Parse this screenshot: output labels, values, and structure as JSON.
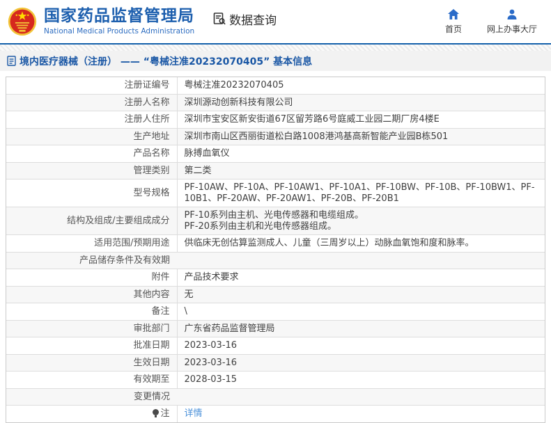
{
  "header": {
    "logo": {
      "title": "国家药品监督管理局",
      "subtitle": "National Medical Products Administration"
    },
    "section": {
      "label": "数据查询"
    },
    "nav": [
      {
        "label": "首页"
      },
      {
        "label": "网上办事大厅"
      }
    ]
  },
  "breadcrumb": {
    "text": "境内医疗器械（注册） —— “粤械注准20232070405” 基本信息"
  },
  "table": {
    "rows": [
      {
        "label": "注册证编号",
        "value": "粤械注准20232070405"
      },
      {
        "label": "注册人名称",
        "value": "深圳源动创新科技有限公司"
      },
      {
        "label": "注册人住所",
        "value": "深圳市宝安区新安街道67区留芳路6号庭威工业园二期厂房4楼E"
      },
      {
        "label": "生产地址",
        "value": "深圳市南山区西丽街道松白路1008港鸿基高新智能产业园B栋501"
      },
      {
        "label": "产品名称",
        "value": "脉搏血氧仪"
      },
      {
        "label": "管理类别",
        "value": "第二类"
      },
      {
        "label": "型号规格",
        "value": "PF-10AW、PF-10A、PF-10AW1、PF-10A1、PF-10BW、PF-10B、PF-10BW1、PF-10B1、PF-20AW、PF-20AW1、PF-20B、PF-20B1"
      },
      {
        "label": "结构及组成/主要组成成分",
        "value": "PF-10系列由主机、光电传感器和电缆组成。\nPF-20系列由主机和光电传感器组成。"
      },
      {
        "label": "适用范围/预期用途",
        "value": "供临床无创估算监测成人、儿童（三周岁以上）动脉血氧饱和度和脉率。"
      },
      {
        "label": "产品储存条件及有效期",
        "value": ""
      },
      {
        "label": "附件",
        "value": "产品技术要求"
      },
      {
        "label": "其他内容",
        "value": "无"
      },
      {
        "label": "备注",
        "value": "\\"
      },
      {
        "label": "审批部门",
        "value": "广东省药品监督管理局"
      },
      {
        "label": "批准日期",
        "value": "2023-03-16"
      },
      {
        "label": "生效日期",
        "value": "2023-03-16"
      },
      {
        "label": "有效期至",
        "value": "2028-03-15"
      },
      {
        "label": "变更情况",
        "value": ""
      },
      {
        "label": "注",
        "value": "详情",
        "value_is_link": true,
        "label_icon": "lightbulb-icon"
      }
    ]
  },
  "colors": {
    "brand_blue": "#1d5fae",
    "nav_icon_blue": "#2a6bc8",
    "breadcrumb_blue": "#1a57a5",
    "link_blue": "#4a90d9",
    "alt_row_bg": "#f7f7f7",
    "emblem_red": "#d6281e",
    "emblem_gold": "#f2c438"
  }
}
